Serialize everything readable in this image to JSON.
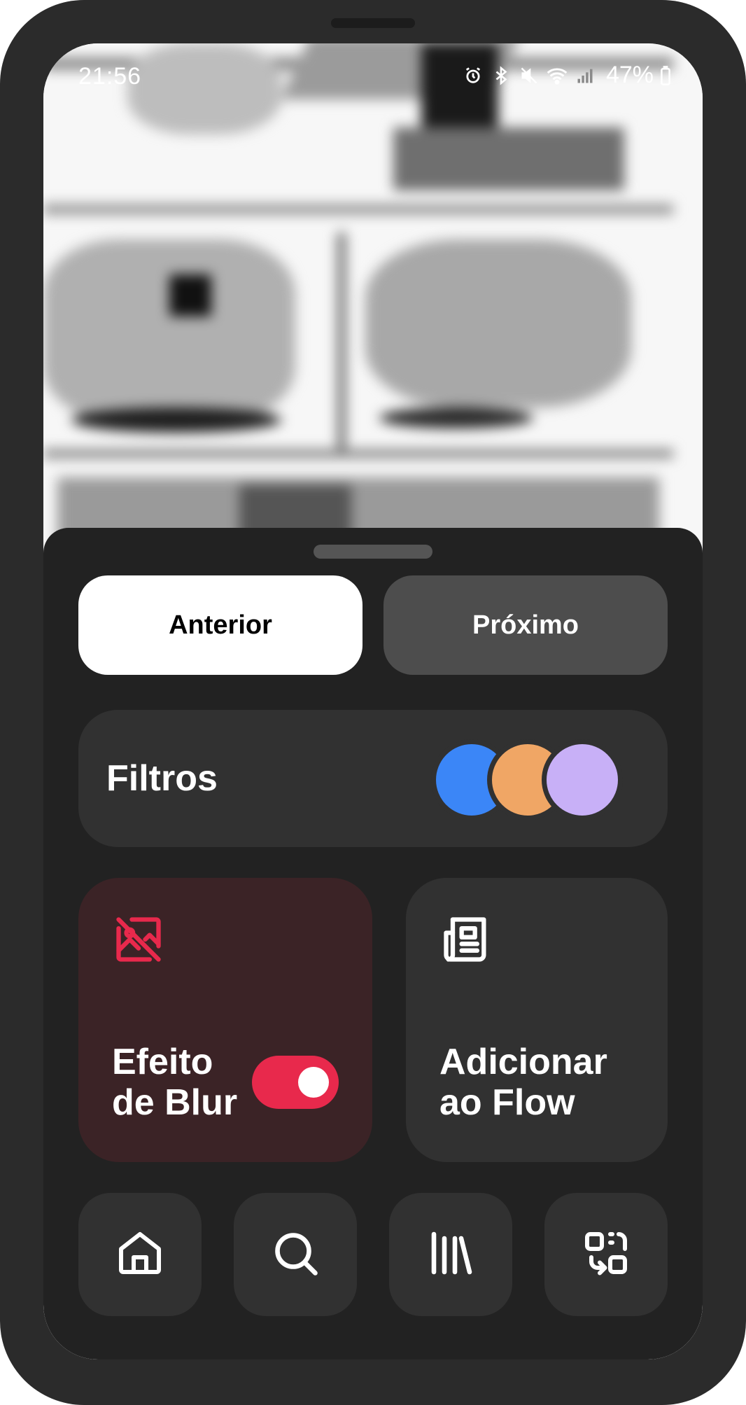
{
  "status_bar": {
    "time": "21:56",
    "battery": "47%",
    "icons": [
      "alarm-icon",
      "bluetooth-icon",
      "mute-icon",
      "wifi-icon",
      "signal-icon",
      "battery-icon"
    ]
  },
  "navigation": {
    "previous_label": "Anterior",
    "next_label": "Próximo"
  },
  "filters": {
    "label": "Filtros",
    "swatches": [
      "#3b86f7",
      "#f0a665",
      "#c8b0f7"
    ]
  },
  "blur_tile": {
    "label_line1": "Efeito",
    "label_line2": "de Blur",
    "icon": "image-off-icon",
    "enabled": true,
    "accent": "#e8294c"
  },
  "flow_tile": {
    "label_line1": "Adicionar",
    "label_line2": "ao Flow",
    "icon": "newspaper-icon"
  },
  "dock": {
    "icons": [
      "home-icon",
      "search-icon",
      "library-icon",
      "transfer-icon"
    ]
  },
  "colors": {
    "sheet_background": "#222222",
    "card_background": "#313131",
    "blur_tile_background": "#3b2326"
  }
}
